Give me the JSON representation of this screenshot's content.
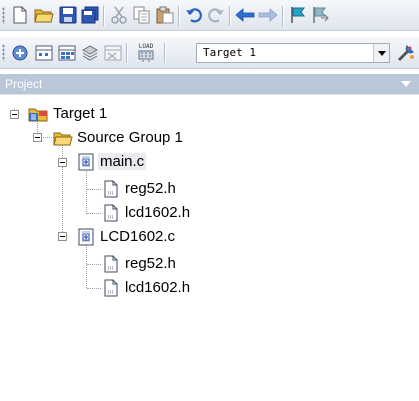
{
  "toolbar_main": {
    "icons": [
      "new-file-icon",
      "open-folder-icon",
      "save-icon",
      "save-all-icon",
      "cut-icon",
      "copy-icon",
      "paste-icon",
      "undo-icon",
      "redo-icon",
      "navigate-back-icon",
      "navigate-forward-icon",
      "bookmark-icon",
      "bookmark-next-icon"
    ]
  },
  "toolbar_build": {
    "icons": [
      "translate-icon",
      "build-icon",
      "rebuild-icon",
      "batch-build-icon",
      "stop-build-icon",
      "download-icon"
    ],
    "download_label": "LOAD",
    "target_select": "Target 1",
    "options_icon": "target-options-icon"
  },
  "project_panel": {
    "title": "Project"
  },
  "tree": {
    "target": "Target 1",
    "group": "Source Group 1",
    "file1": "main.c",
    "file1_children": [
      "reg52.h",
      "lcd1602.h"
    ],
    "file2": "LCD1602.c",
    "file2_children": [
      "reg52.h",
      "lcd1602.h"
    ]
  },
  "colors": {
    "panel_header": "#b9c7d9",
    "toolbar_top": "#f5f7fb",
    "toolbar_bottom": "#dfe5ee"
  }
}
